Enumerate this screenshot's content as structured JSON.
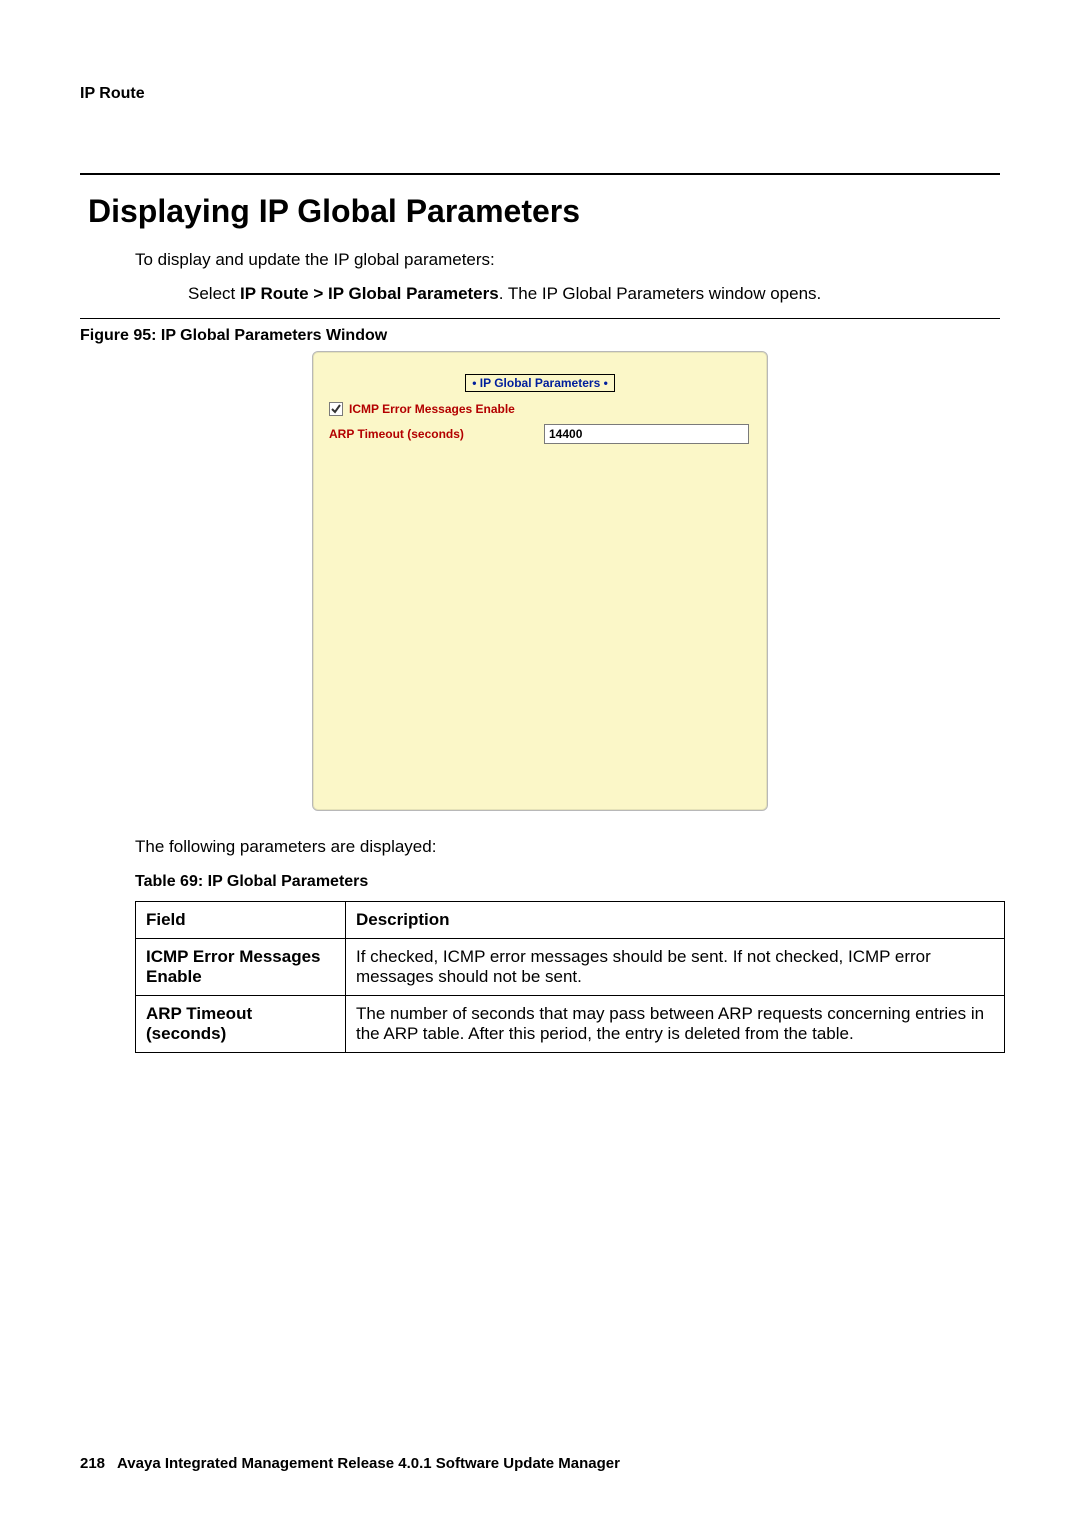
{
  "breadcrumb": "IP Route",
  "heading": "Displaying IP Global Parameters",
  "intro_line": "To display and update the IP global parameters:",
  "step_prefix": "Select ",
  "step_bold": "IP Route > IP Global Parameters",
  "step_suffix": ". The IP Global Parameters window opens.",
  "figure_caption": "Figure 95: IP Global Parameters Window",
  "panel": {
    "title": "• IP Global Parameters •",
    "icmp_label": "ICMP Error Messages Enable",
    "arp_label": "ARP Timeout (seconds)",
    "arp_value": "14400",
    "icmp_checked": true
  },
  "followup_text": "The following parameters are displayed:",
  "table_caption": "Table 69: IP Global Parameters",
  "table": {
    "headers": {
      "field": "Field",
      "desc": "Description"
    },
    "rows": [
      {
        "field": "ICMP Error Messages Enable",
        "desc": "If checked, ICMP error messages should be sent. If not checked, ICMP error messages should not be sent."
      },
      {
        "field": "ARP Timeout (seconds)",
        "desc": "The number of seconds that may pass between ARP requests concerning entries in the ARP table. After this period, the entry is deleted from the table."
      }
    ]
  },
  "footer": {
    "page": "218",
    "doc": "Avaya Integrated Management Release 4.0.1 Software Update Manager"
  }
}
